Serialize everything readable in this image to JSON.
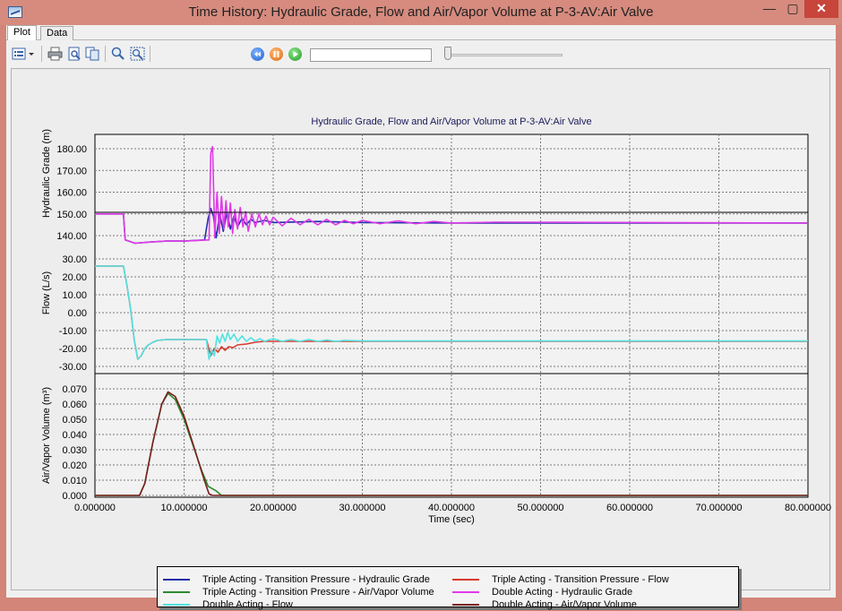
{
  "window": {
    "title": "Time History: Hydraulic Grade, Flow and Air/Vapor Volume at P-3-AV:Air Valve",
    "minimize": "—",
    "maximize": "▢",
    "close": "✕"
  },
  "tabs": [
    {
      "label": "Plot",
      "active": true
    },
    {
      "label": "Data",
      "active": false
    }
  ],
  "toolbar": {
    "icons": [
      "chart-options-icon",
      "dropdown-icon",
      "print-icon",
      "print-preview-icon",
      "copy-icon",
      "zoom-icon",
      "zoom-window-icon"
    ],
    "playback": {
      "rewind": "rewind-icon",
      "pause": "pause-icon",
      "play": "play-icon",
      "progress": 0,
      "slider": 0
    }
  },
  "colors": {
    "triple_hgl": "#1f2fa8",
    "triple_flow": "#d83a2f",
    "triple_vol": "#2e8a2e",
    "double_hgl": "#e03ae8",
    "double_flow": "#4fe3e3",
    "double_vol": "#7a1e1e"
  },
  "chart_data": {
    "type": "line",
    "title": "Hydraulic Grade, Flow and Air/Vapor Volume at P-3-AV:Air Valve",
    "xlabel": "Time (sec)",
    "xlim": [
      0,
      80
    ],
    "x_ticks": [
      "0.000000",
      "10.000000",
      "20.000000",
      "30.000000",
      "40.000000",
      "50.000000",
      "60.000000",
      "70.000000",
      "80.000000"
    ],
    "grid": true,
    "legend_placement": "bottom-center",
    "panels": [
      {
        "ylabel": "Hydraulic Grade (m)",
        "ylim": [
          130,
          190
        ],
        "y_ticks": [
          "140.00",
          "150.00",
          "160.00",
          "170.00",
          "180.00"
        ],
        "series": [
          {
            "name": "Triple Acting - Transition Pressure - Hydraulic Grade",
            "color_key": "triple_hgl",
            "x": [
              0,
              3.2,
              3.4,
              4.5,
              6,
              8,
              10,
              12.3,
              12.7,
              13.0,
              13.3,
              13.6,
              14.0,
              14.4,
              14.8,
              15.2,
              15.6,
              16.0,
              16.5,
              17,
              17.5,
              18,
              19,
              20,
              25,
              30,
              40,
              80
            ],
            "y": [
              150,
              150,
              138,
              136.5,
              137,
              137.5,
              137.5,
              138,
              148,
              152.5,
              149,
              139,
              150,
              142,
              151,
              143,
              149,
              144,
              148,
              145,
              147.5,
              146,
              147,
              146,
              146.5,
              146,
              145.8,
              145.8
            ]
          },
          {
            "name": "Double Acting - Hydraulic Grade",
            "color_key": "double_hgl",
            "x": [
              0,
              3.2,
              3.4,
              4.5,
              6,
              8,
              10,
              12.8,
              13.0,
              13.2,
              13.45,
              13.7,
              13.95,
              14.2,
              14.45,
              14.7,
              14.95,
              15.2,
              15.45,
              15.7,
              16.0,
              16.3,
              16.6,
              16.9,
              17.2,
              17.6,
              18.0,
              18.4,
              18.8,
              19.2,
              19.6,
              20,
              21,
              22,
              23,
              24,
              25,
              26,
              27,
              28,
              29,
              30,
              32,
              34,
              36,
              38,
              40,
              45,
              80
            ],
            "y": [
              150,
              150,
              138,
              136.5,
              137,
              137.5,
              137.5,
              138,
              178,
              181,
              139,
              160,
              141,
              158,
              143,
              156,
              144,
              155,
              141,
              152,
              143,
              153,
              144,
              151,
              142,
              150,
              144,
              150,
              145,
              149,
              145,
              148.5,
              144.5,
              148,
              145,
              147.5,
              145,
              147.5,
              145,
              147,
              145.5,
              147,
              145.5,
              146.8,
              145.5,
              146.5,
              145.8,
              146.2,
              145.8
            ]
          }
        ]
      },
      {
        "ylabel": "Flow (L/s)",
        "ylim": [
          -32,
          32
        ],
        "y_ticks": [
          "-30.00",
          "-20.00",
          "-10.00",
          "0.00",
          "10.00",
          "20.00",
          "30.00"
        ],
        "series": [
          {
            "name": "Triple Acting - Transition Pressure - Flow",
            "color_key": "triple_flow",
            "x": [
              0,
              3.2,
              3.6,
              4.0,
              4.4,
              4.8,
              5.2,
              5.6,
              6.0,
              6.5,
              7,
              8,
              10,
              12.5,
              13.0,
              13.4,
              13.8,
              14.2,
              14.6,
              15.0,
              15.5,
              16.0,
              17,
              18,
              19,
              20,
              25,
              30,
              80
            ],
            "y": [
              26,
              26,
              15,
              2,
              -15,
              -26,
              -24,
              -20,
              -18,
              -16.5,
              -15.5,
              -15,
              -15,
              -15,
              -24,
              -20,
              -22,
              -19,
              -21,
              -19,
              -19.5,
              -18,
              -17.5,
              -16.5,
              -16,
              -16,
              -16,
              -16,
              -16
            ]
          },
          {
            "name": "Double Acting - Flow",
            "color_key": "double_flow",
            "x": [
              0,
              3.2,
              3.6,
              4.0,
              4.4,
              4.8,
              5.2,
              5.6,
              6.0,
              6.5,
              7,
              8,
              10,
              12.5,
              12.8,
              13.1,
              13.4,
              13.7,
              14.0,
              14.3,
              14.6,
              14.9,
              15.2,
              15.6,
              16.0,
              16.5,
              17.0,
              17.5,
              18.0,
              18.5,
              19.0,
              20,
              21,
              22,
              23,
              24,
              25,
              26,
              27,
              28,
              30,
              35,
              80
            ],
            "y": [
              26,
              26,
              15,
              2,
              -15,
              -26,
              -24,
              -20,
              -18,
              -16.5,
              -15.5,
              -15,
              -15,
              -15,
              -26,
              -21,
              -24,
              -13,
              -17,
              -12,
              -16,
              -11,
              -15,
              -12,
              -16,
              -13,
              -16,
              -14,
              -16,
              -14.5,
              -16,
              -14.5,
              -16,
              -15,
              -16,
              -15,
              -16,
              -15.3,
              -16,
              -15.5,
              -15.8,
              -15.8,
              -15.8
            ]
          }
        ]
      },
      {
        "ylabel": "Air/Vapor Volume (m³)",
        "ylim": [
          0,
          0.072
        ],
        "y_ticks": [
          "0.000",
          "0.010",
          "0.020",
          "0.030",
          "0.040",
          "0.050",
          "0.060",
          "0.070"
        ],
        "series": [
          {
            "name": "Triple Acting - Transition Pressure - Air/Vapor Volume",
            "color_key": "triple_vol",
            "x": [
              0,
              5.0,
              5.6,
              6.5,
              7.5,
              8.2,
              9.0,
              10.0,
              11.0,
              12.0,
              12.7,
              13.6,
              14.2,
              14.6,
              80
            ],
            "y": [
              0,
              0,
              0.008,
              0.035,
              0.06,
              0.067,
              0.063,
              0.05,
              0.033,
              0.016,
              0.006,
              0.003,
              0,
              0,
              0
            ]
          },
          {
            "name": "Double Acting - Air/Vapor Volume",
            "color_key": "double_vol",
            "x": [
              0,
              5.0,
              5.6,
              6.5,
              7.5,
              8.2,
              9.0,
              10.0,
              11.0,
              12.0,
              12.5,
              12.8,
              13.2,
              80
            ],
            "y": [
              0,
              0,
              0.008,
              0.035,
              0.06,
              0.068,
              0.065,
              0.052,
              0.034,
              0.015,
              0.006,
              0.001,
              0,
              0
            ]
          }
        ]
      }
    ]
  },
  "legend": {
    "entries": [
      {
        "label": "Triple Acting - Transition Pressure - Hydraulic Grade",
        "color_key": "triple_hgl"
      },
      {
        "label": "Triple Acting - Transition Pressure - Flow",
        "color_key": "triple_flow"
      },
      {
        "label": "Triple Acting - Transition Pressure - Air/Vapor Volume",
        "color_key": "triple_vol"
      },
      {
        "label": "Double Acting - Hydraulic Grade",
        "color_key": "double_hgl"
      },
      {
        "label": "Double Acting - Flow",
        "color_key": "double_flow"
      },
      {
        "label": "Double Acting - Air/Vapor Volume",
        "color_key": "double_vol"
      }
    ]
  }
}
